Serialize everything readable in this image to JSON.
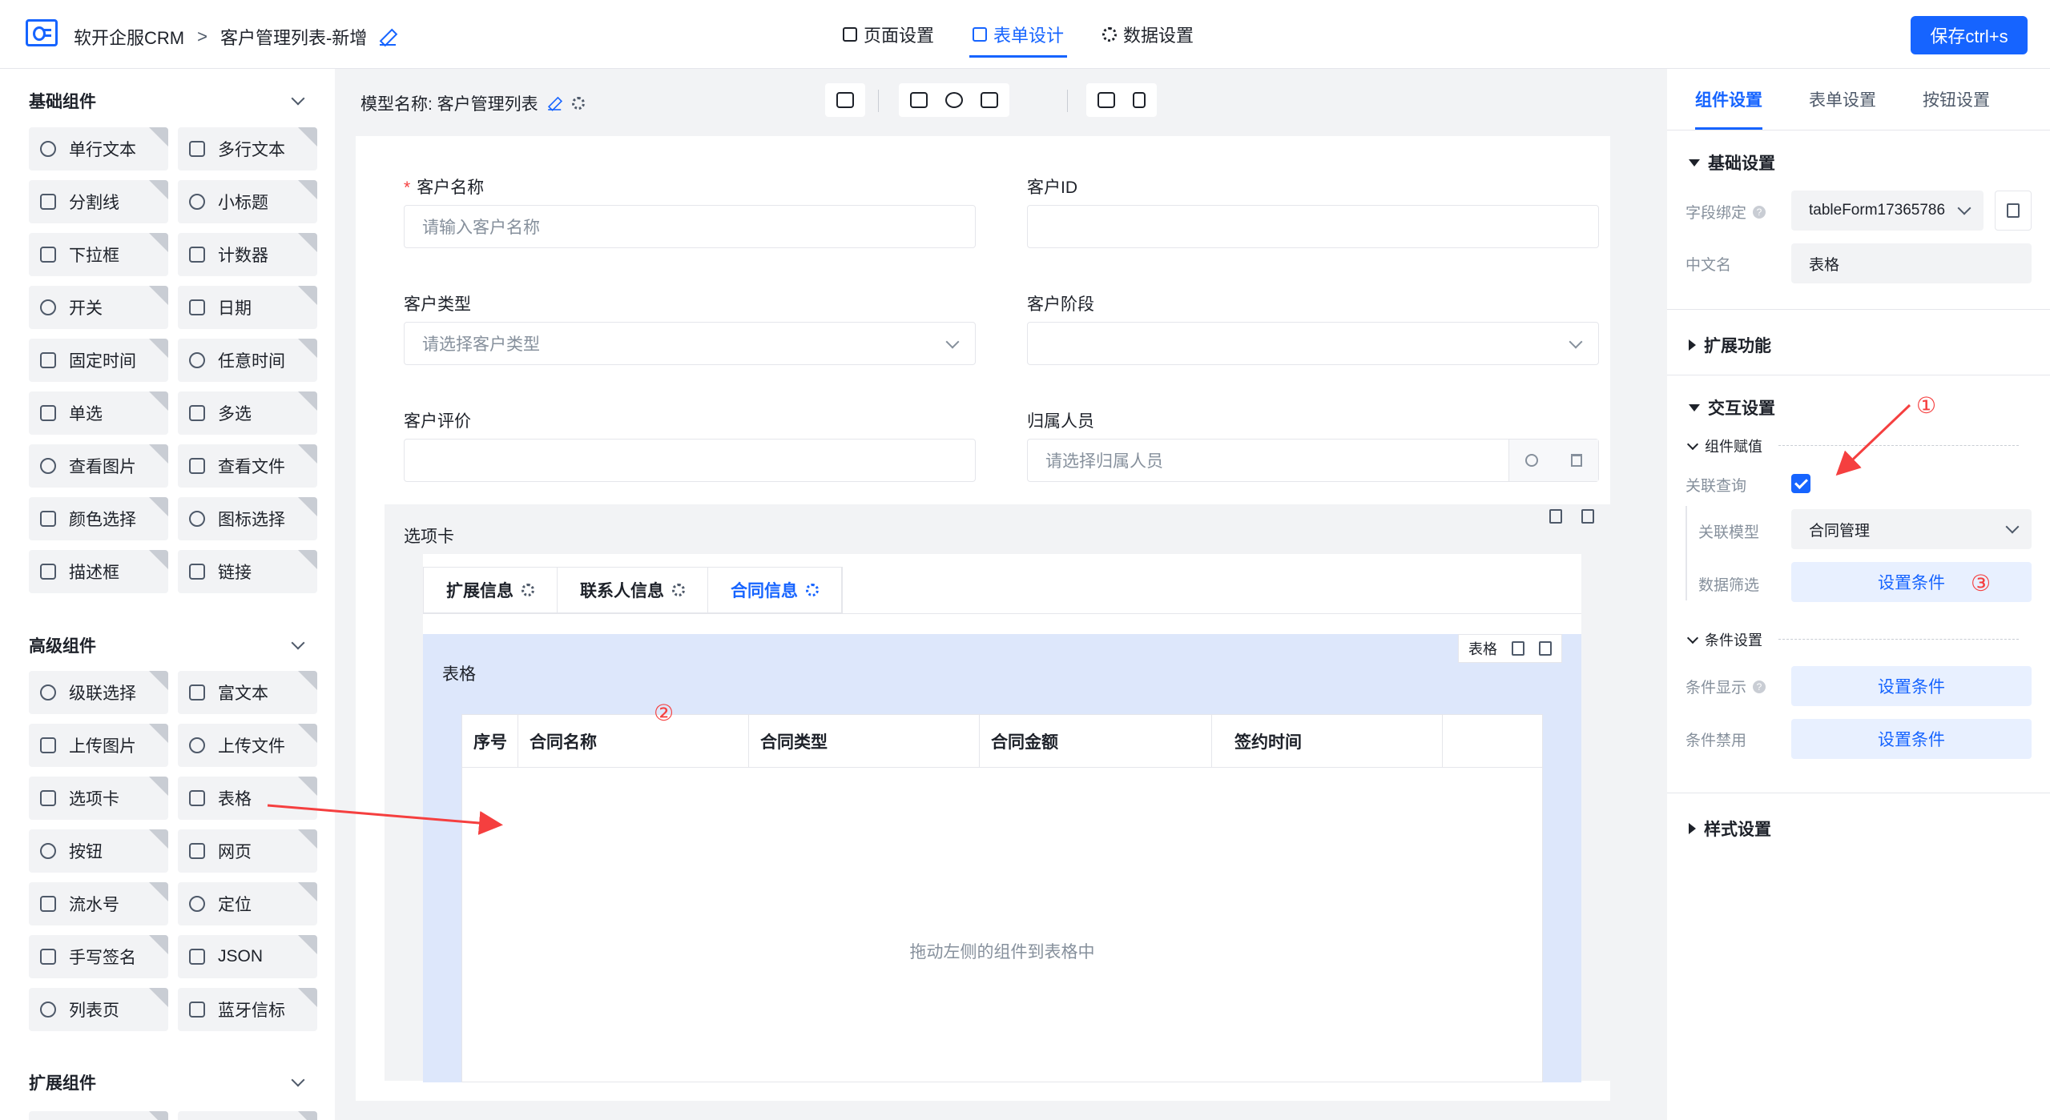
{
  "header": {
    "app_name": "软开企服CRM",
    "separator": ">",
    "page_name": "客户管理列表-新增",
    "tabs": [
      {
        "label": "页面设置",
        "icon": "bookmark-icon"
      },
      {
        "label": "表单设计",
        "icon": "document-icon",
        "active": true
      },
      {
        "label": "数据设置",
        "icon": "gear-icon"
      }
    ],
    "save_label": "保存ctrl+s"
  },
  "sidebar": {
    "basic": {
      "title": "基础组件",
      "items": [
        "单行文本",
        "多行文本",
        "分割线",
        "小标题",
        "下拉框",
        "计数器",
        "开关",
        "日期",
        "固定时间",
        "任意时间",
        "单选",
        "多选",
        "查看图片",
        "查看文件",
        "颜色选择",
        "图标选择",
        "描述框",
        "链接"
      ]
    },
    "advanced": {
      "title": "高级组件",
      "items": [
        "级联选择",
        "富文本",
        "上传图片",
        "上传文件",
        "选项卡",
        "表格",
        "按钮",
        "网页",
        "流水号",
        "定位",
        "手写签名",
        "JSON",
        "列表页",
        "蓝牙信标"
      ]
    },
    "extension": {
      "title": "扩展组件"
    }
  },
  "canvas": {
    "model_label": "模型名称: 客户管理列表",
    "fields": [
      {
        "label": "客户名称",
        "required": true,
        "placeholder": "请输入客户名称"
      },
      {
        "label": "客户ID",
        "placeholder": ""
      },
      {
        "label": "客户类型",
        "placeholder": "请选择客户类型"
      },
      {
        "label": "客户阶段",
        "placeholder": ""
      },
      {
        "label": "客户评价",
        "placeholder": ""
      },
      {
        "label": "归属人员",
        "placeholder": "请选择归属人员"
      }
    ],
    "tabs_label": "选项卡",
    "tabs": [
      "扩展信息",
      "联系人信息",
      "合同信息"
    ],
    "table": {
      "label": "表格",
      "action_label": "表格",
      "columns": [
        "序号",
        "合同名称",
        "合同类型",
        "合同金额",
        "签约时间"
      ],
      "empty_text": "拖动左侧的组件到表格中"
    }
  },
  "right_panel": {
    "tabs": [
      "组件设置",
      "表单设置",
      "按钮设置"
    ],
    "basic_settings": {
      "title": "基础设置",
      "field_binding_label": "字段绑定",
      "field_binding_value": "tableForm17365786",
      "cn_name_label": "中文名",
      "cn_name_value": "表格"
    },
    "extend_title": "扩展功能",
    "interaction": {
      "title": "交互设置",
      "assign_title": "组件赋值",
      "related_query_label": "关联查询",
      "related_model_label": "关联模型",
      "related_model_value": "合同管理",
      "data_filter_label": "数据筛选",
      "set_condition": "设置条件",
      "condition_title": "条件设置",
      "cond_show_label": "条件显示",
      "cond_disable_label": "条件禁用"
    },
    "style_title": "样式设置"
  },
  "annotations": [
    "①",
    "②",
    "③"
  ],
  "colors": {
    "accent": "#1664ff",
    "annotation": "#f53f3f"
  }
}
